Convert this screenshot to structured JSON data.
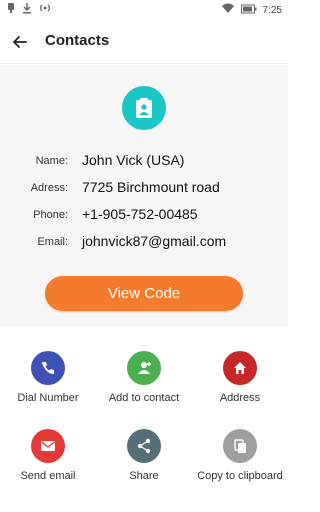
{
  "status_bar": {
    "time": "7:25"
  },
  "app_bar": {
    "title": "Contacts"
  },
  "contact": {
    "fields": [
      {
        "label": "Name:",
        "value": "John Vick (USA)"
      },
      {
        "label": "Adress:",
        "value": "7725 Birchmount road"
      },
      {
        "label": "Phone:",
        "value": "+1-905-752-00485"
      },
      {
        "label": "Email:",
        "value": "johnvick87@gmail.com"
      }
    ],
    "view_code_label": "View Code"
  },
  "actions": [
    {
      "label": "Dial Number",
      "icon": "phone-icon",
      "color": "#3f51b5"
    },
    {
      "label": "Add to contact",
      "icon": "add-contact-icon",
      "color": "#4caf50"
    },
    {
      "label": "Address",
      "icon": "home-icon",
      "color": "#c62828"
    },
    {
      "label": "Send email",
      "icon": "email-icon",
      "color": "#e53935"
    },
    {
      "label": "Share",
      "icon": "share-icon",
      "color": "#546e7a"
    },
    {
      "label": "Copy to clipboard",
      "icon": "copy-icon",
      "color": "#9e9e9e"
    }
  ],
  "colors": {
    "accent": "#f47a2c",
    "badge": "#1ac6c6"
  }
}
